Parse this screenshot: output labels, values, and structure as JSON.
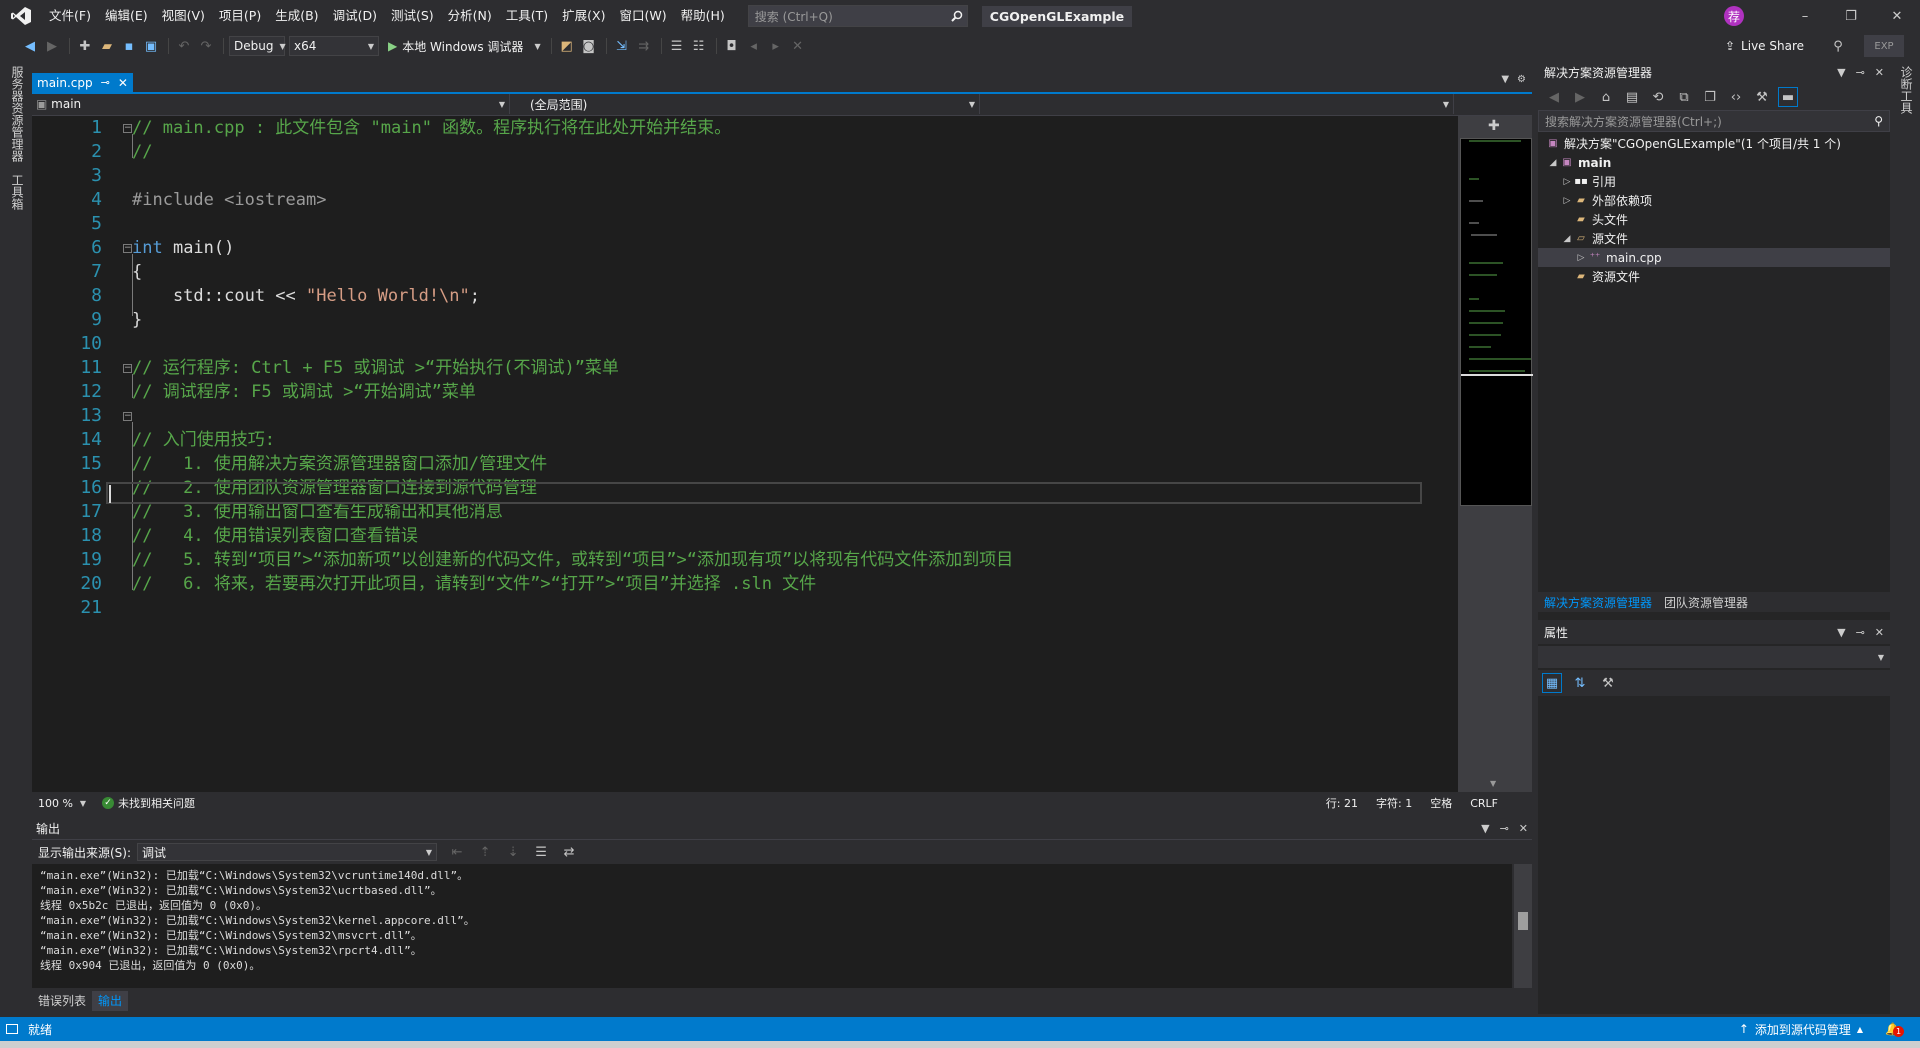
{
  "menu": [
    "文件(F)",
    "编辑(E)",
    "视图(V)",
    "项目(P)",
    "生成(B)",
    "调试(D)",
    "测试(S)",
    "分析(N)",
    "工具(T)",
    "扩展(X)",
    "窗口(W)",
    "帮助(H)"
  ],
  "search": {
    "placeholder": "搜索 (Ctrl+Q)"
  },
  "solution_name": "CGOpenGLExample",
  "user_initial": "荐",
  "window_controls": {
    "minimize": "–",
    "restore": "❐",
    "close": "✕"
  },
  "toolbar": {
    "config": "Debug",
    "platform": "x64",
    "run_label": "本地 Windows 调试器",
    "live_share": "Live Share",
    "exp": "EXP"
  },
  "left_tabs": [
    "服务器资源管理器",
    "工具箱"
  ],
  "right_tabs": [
    "诊断工具"
  ],
  "editor": {
    "tab_name": "main.cpp",
    "pin_icon": "⊸",
    "nav_project": "main",
    "nav_scope": "(全局范围)",
    "lines": [
      {
        "n": "1"
      },
      {
        "n": "2"
      },
      {
        "n": "3"
      },
      {
        "n": "4"
      },
      {
        "n": "5"
      },
      {
        "n": "6"
      },
      {
        "n": "7"
      },
      {
        "n": "8"
      },
      {
        "n": "9"
      },
      {
        "n": "10"
      },
      {
        "n": "11"
      },
      {
        "n": "12"
      },
      {
        "n": "13"
      },
      {
        "n": "14"
      },
      {
        "n": "15"
      },
      {
        "n": "16"
      },
      {
        "n": "17"
      },
      {
        "n": "18"
      },
      {
        "n": "19"
      },
      {
        "n": "20"
      },
      {
        "n": "21"
      }
    ],
    "code": {
      "l1": "// main.cpp : 此文件包含 \"main\" 函数。程序执行将在此处开始并结束。",
      "l2": "//",
      "l4": "#include <iostream>",
      "l6_kw": "int",
      "l6_rest": " main()",
      "l7": "{",
      "l8_a": "    std::cout << ",
      "l8_str": "\"Hello World!\\n\"",
      "l8_b": ";",
      "l9": "}",
      "l11": "// 运行程序: Ctrl + F5 或调试 >“开始执行(不调试)”菜单",
      "l12": "// 调试程序: F5 或调试 >“开始调试”菜单",
      "l14": "// 入门使用技巧:",
      "l15": "//   1. 使用解决方案资源管理器窗口添加/管理文件",
      "l16": "//   2. 使用团队资源管理器窗口连接到源代码管理",
      "l17": "//   3. 使用输出窗口查看生成输出和其他消息",
      "l18": "//   4. 使用错误列表窗口查看错误",
      "l19": "//   5. 转到“项目”>“添加新项”以创建新的代码文件，或转到“项目”>“添加现有项”以将现有代码文件添加到项目",
      "l20": "//   6. 将来，若要再次打开此项目，请转到“文件”>“打开”>“项目”并选择 .sln 文件"
    },
    "zoom": "100 %",
    "issues": "未找到相关问题",
    "row": "行: 21",
    "col": "字符: 1",
    "spacing": "空格",
    "eol": "CRLF"
  },
  "output": {
    "title": "输出",
    "source_label": "显示输出来源(S):",
    "source_value": "调试",
    "text": "“main.exe”(Win32): 已加载“C:\\Windows\\System32\\vcruntime140d.dll”。\n“main.exe”(Win32): 已加载“C:\\Windows\\System32\\ucrtbased.dll”。\n线程 0x5b2c 已退出，返回值为 0 (0x0)。\n“main.exe”(Win32): 已加载“C:\\Windows\\System32\\kernel.appcore.dll”。\n“main.exe”(Win32): 已加载“C:\\Windows\\System32\\msvcrt.dll”。\n“main.exe”(Win32): 已加载“C:\\Windows\\System32\\rpcrt4.dll”。\n线程 0x904 已退出，返回值为 0 (0x0)。",
    "tabs": [
      "错误列表",
      "输出"
    ]
  },
  "solution_explorer": {
    "title": "解决方案资源管理器",
    "search_placeholder": "搜索解决方案资源管理器(Ctrl+;)",
    "tree": [
      {
        "label": "解决方案\"CGOpenGLExample\"(1 个项目/共 1 个)"
      },
      {
        "label": "main"
      },
      {
        "label": "引用"
      },
      {
        "label": "外部依赖项"
      },
      {
        "label": "头文件"
      },
      {
        "label": "源文件"
      },
      {
        "label": "main.cpp"
      },
      {
        "label": "资源文件"
      }
    ],
    "bottom_tabs": [
      "解决方案资源管理器",
      "团队资源管理器"
    ]
  },
  "properties": {
    "title": "属性"
  },
  "statusbar": {
    "ready": "就绪",
    "source_control": "添加到源代码管理",
    "notifications": "1"
  },
  "colors": {
    "accent": "#007acc",
    "comment": "#57a64a",
    "keyword": "#569cd6",
    "string": "#d69d85",
    "line_number": "#2b91af",
    "editor_bg": "#1e1e1e"
  }
}
